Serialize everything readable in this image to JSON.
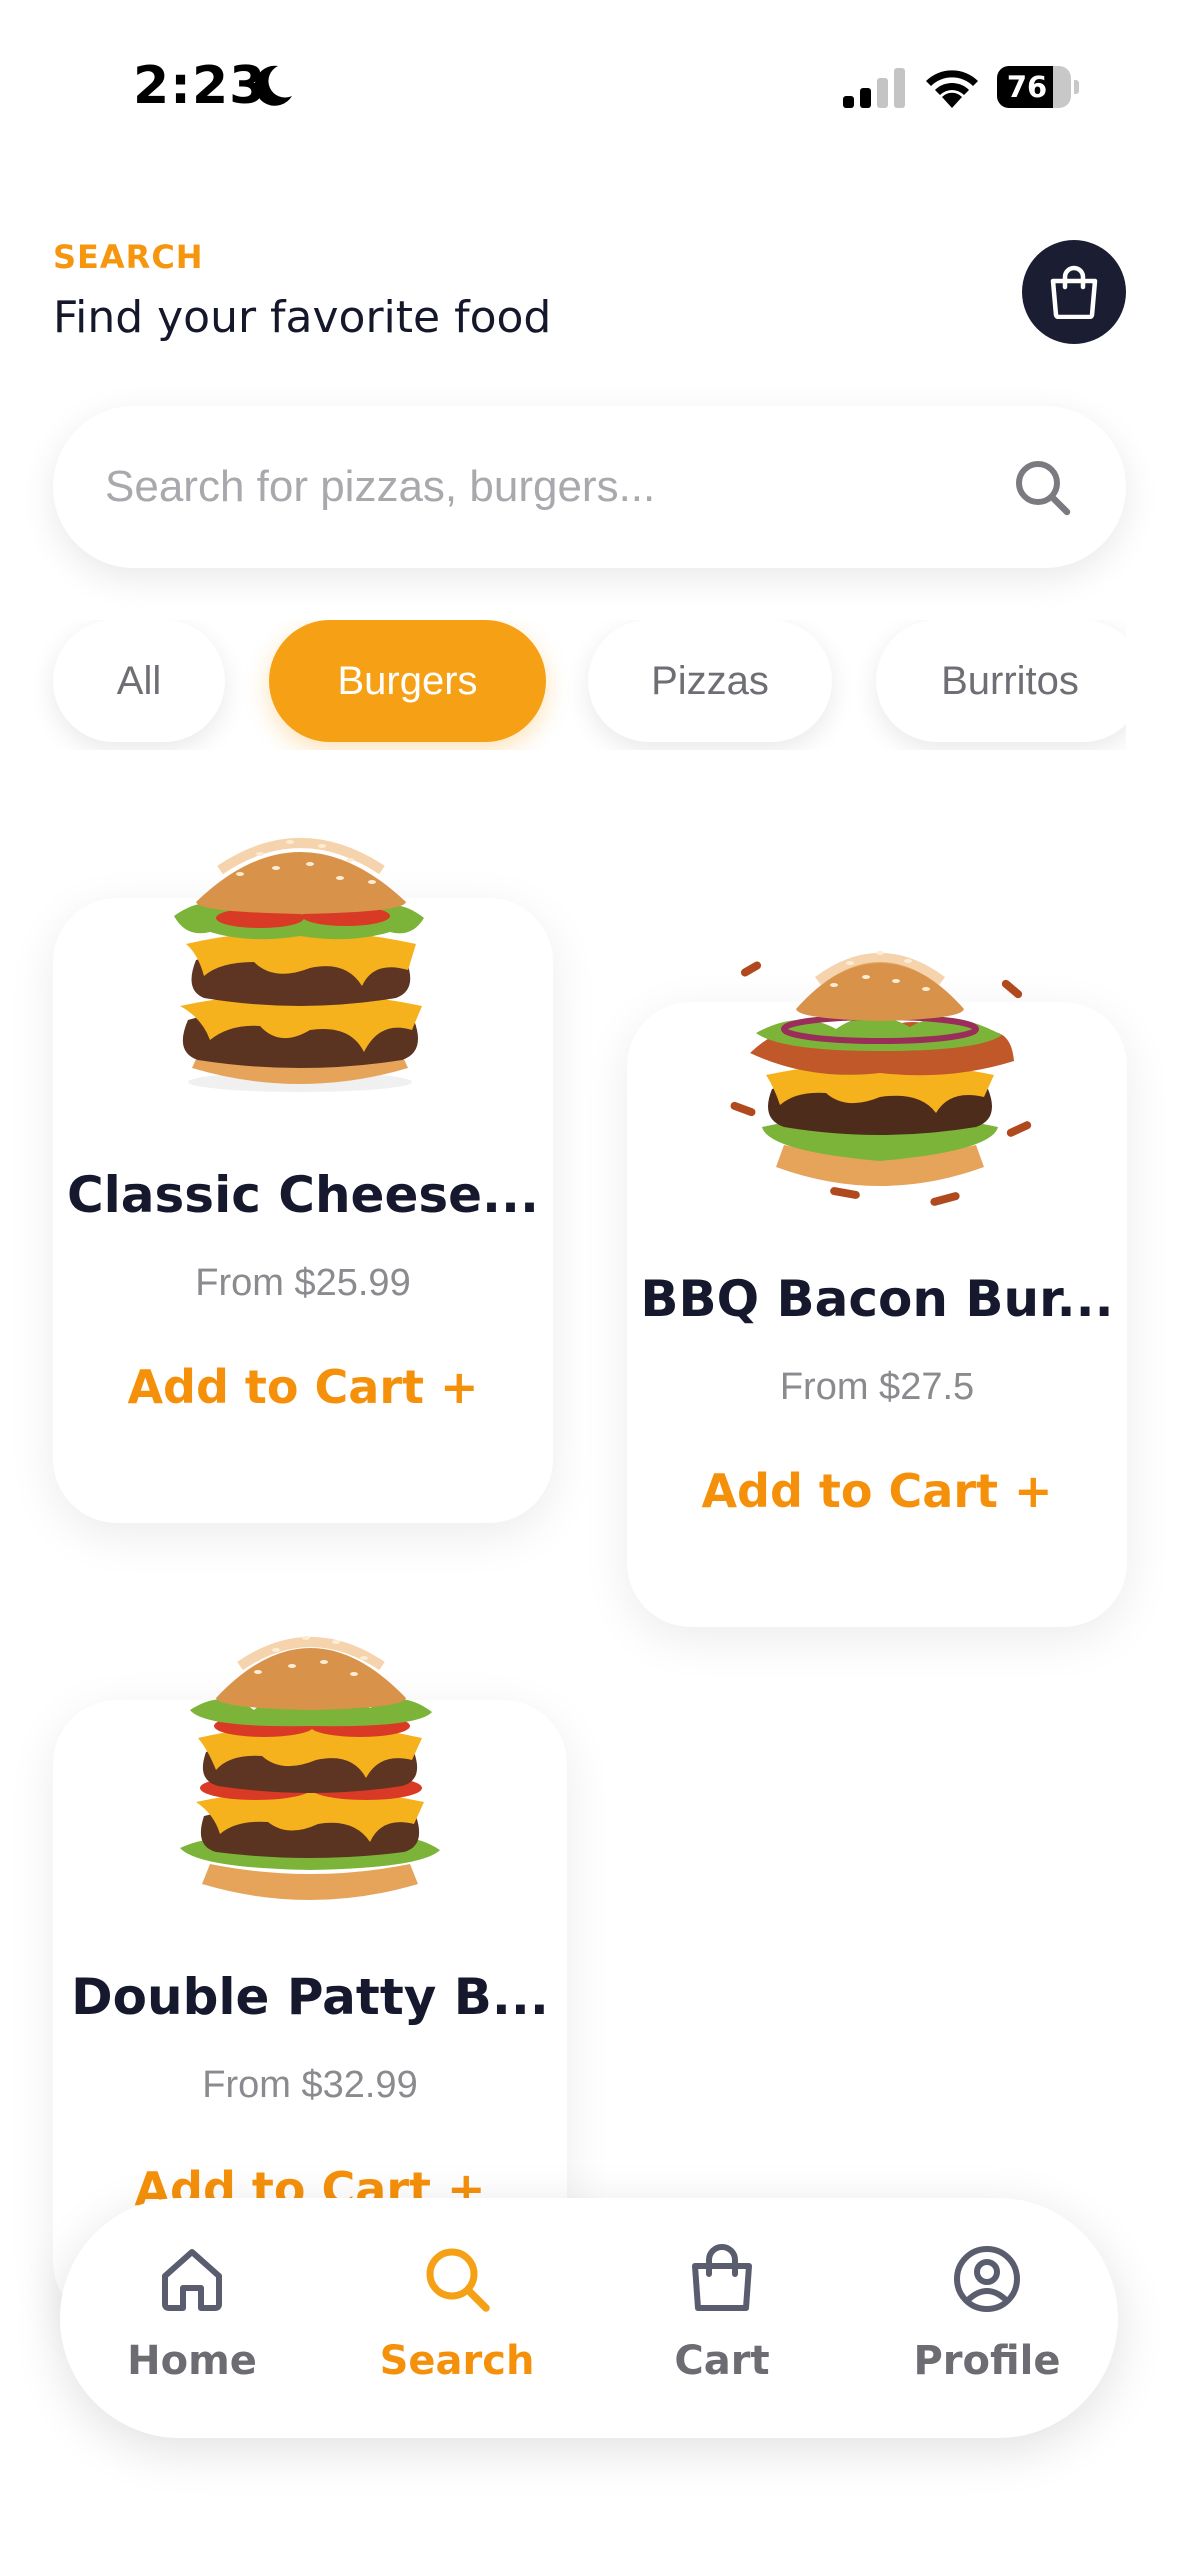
{
  "status_bar": {
    "time": "2:23",
    "battery": "76",
    "battery_level": 0.76
  },
  "header": {
    "eyebrow": "SEARCH",
    "title": "Find your favorite food"
  },
  "search": {
    "placeholder": "Search for pizzas, burgers..."
  },
  "categories": [
    {
      "label": "All",
      "active": false
    },
    {
      "label": "Burgers",
      "active": true
    },
    {
      "label": "Pizzas",
      "active": false
    },
    {
      "label": "Burritos",
      "active": false
    }
  ],
  "products": [
    {
      "name": "Classic Cheese...",
      "price": "From $25.99",
      "cta": "Add to Cart +"
    },
    {
      "name": "BBQ Bacon Bur...",
      "price": "From $27.5",
      "cta": "Add to Cart +"
    },
    {
      "name": "Double Patty B...",
      "price": "From $32.99",
      "cta": "Add to Cart +"
    }
  ],
  "nav": [
    {
      "label": "Home",
      "icon": "home-icon",
      "active": false
    },
    {
      "label": "Search",
      "icon": "search-icon",
      "active": true
    },
    {
      "label": "Cart",
      "icon": "bag-icon",
      "active": false
    },
    {
      "label": "Profile",
      "icon": "profile-icon",
      "active": false
    }
  ],
  "colors": {
    "accent": "#f5a015",
    "accent_text": "#f5900a",
    "dark": "#1b1d33",
    "muted": "#6c6c72"
  }
}
